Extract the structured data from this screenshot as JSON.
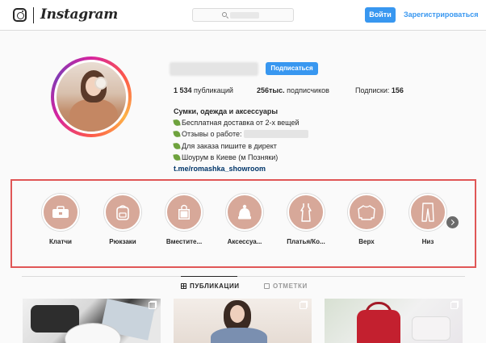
{
  "header": {
    "brand": "Instagram",
    "login_label": "Войти",
    "signup_label": "Зарегистрироваться"
  },
  "profile": {
    "subscribe_label": "Подписаться",
    "stats": {
      "posts_value": "1 534",
      "posts_label": "публикаций",
      "followers_value": "256тыс.",
      "followers_label": "подписчиков",
      "following_label": "Подписки:",
      "following_value": "156"
    },
    "bio": {
      "name": "Сумки, одежда и аксессуары",
      "line1": "Бесплатная доставка от 2-х вещей",
      "line2": "Отзывы о работе:",
      "line3": "Для заказа пишите в директ",
      "line4": "Шоурум в Киеве (м Позняки)",
      "link": "t.me/romashka_showroom"
    }
  },
  "highlights": [
    {
      "label": "Клатчи",
      "icon": "clutch-icon"
    },
    {
      "label": "Рюкзаки",
      "icon": "backpack-icon"
    },
    {
      "label": "Вместите...",
      "icon": "tote-bag-icon"
    },
    {
      "label": "Аксессуа...",
      "icon": "hat-icon"
    },
    {
      "label": "Платья/Ко...",
      "icon": "dress-icon"
    },
    {
      "label": "Верх",
      "icon": "sweater-icon"
    },
    {
      "label": "Низ",
      "icon": "trousers-icon"
    }
  ],
  "tabs": {
    "posts": "ПУБЛИКАЦИИ",
    "tagged": "ОТМЕТКИ"
  },
  "colors": {
    "accent": "#3897f0",
    "highlight_bg": "#d7a899",
    "annotation_border": "#e05656",
    "link": "#003569"
  }
}
